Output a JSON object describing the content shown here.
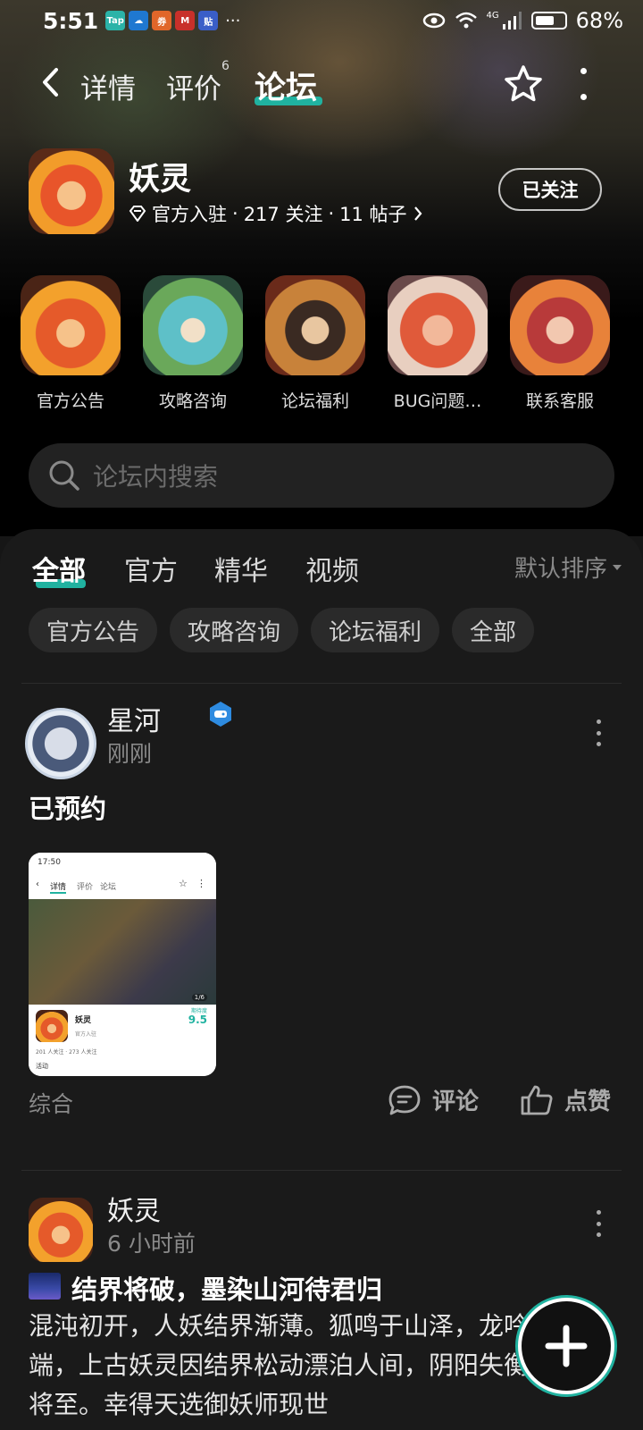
{
  "status_bar": {
    "time": "5:51",
    "notifications": [
      "Tap",
      "☁",
      "券",
      "M",
      "贴"
    ],
    "overflow": "···",
    "network": "4G",
    "battery": "68%"
  },
  "nav": {
    "tabs": [
      {
        "label": "详情"
      },
      {
        "label": "评价",
        "badge": "6"
      },
      {
        "label": "论坛"
      }
    ],
    "active_tab": "论坛"
  },
  "game": {
    "name": "妖灵",
    "meta_official": "官方入驻",
    "meta_follows": "217 关注",
    "meta_posts": "11 帖子",
    "follow_button": "已关注"
  },
  "shortcuts": [
    {
      "label": "官方公告"
    },
    {
      "label": "攻略咨询"
    },
    {
      "label": "论坛福利"
    },
    {
      "label": "BUG问题…"
    },
    {
      "label": "联系客服"
    }
  ],
  "search": {
    "placeholder": "论坛内搜索"
  },
  "feed": {
    "tabs": [
      "全部",
      "官方",
      "精华",
      "视频"
    ],
    "active_tab": "全部",
    "sort_label": "默认排序",
    "chips": [
      "官方公告",
      "攻略咨询",
      "论坛福利",
      "全部"
    ]
  },
  "posts": [
    {
      "author": "星河",
      "time": "刚刚",
      "title": "已预约",
      "category": "综合",
      "comment_label": "评论",
      "like_label": "点赞",
      "thumb": {
        "time": "17:50",
        "tabs": [
          "详情",
          "评价",
          "论坛"
        ],
        "game_name": "妖灵",
        "official": "官方入驻",
        "score_label": "期待度",
        "score": "9.5",
        "page": "1/6",
        "stats": "201 人关注 · 273 人关注",
        "activity": "活动"
      }
    },
    {
      "author": "妖灵",
      "time": "6 小时前",
      "title": "结界将破，墨染山河待君归",
      "body": "混沌初开，人妖结界渐薄。狐鸣于山泽，龙吟于云端，上古妖灵因结界松动漂泊人间，阴阳失衡，浩劫将至。幸得天选御妖师现世"
    }
  ],
  "colors": {
    "accent": "#20b2a0",
    "background": "#161616",
    "card": "#1a1a1a"
  }
}
